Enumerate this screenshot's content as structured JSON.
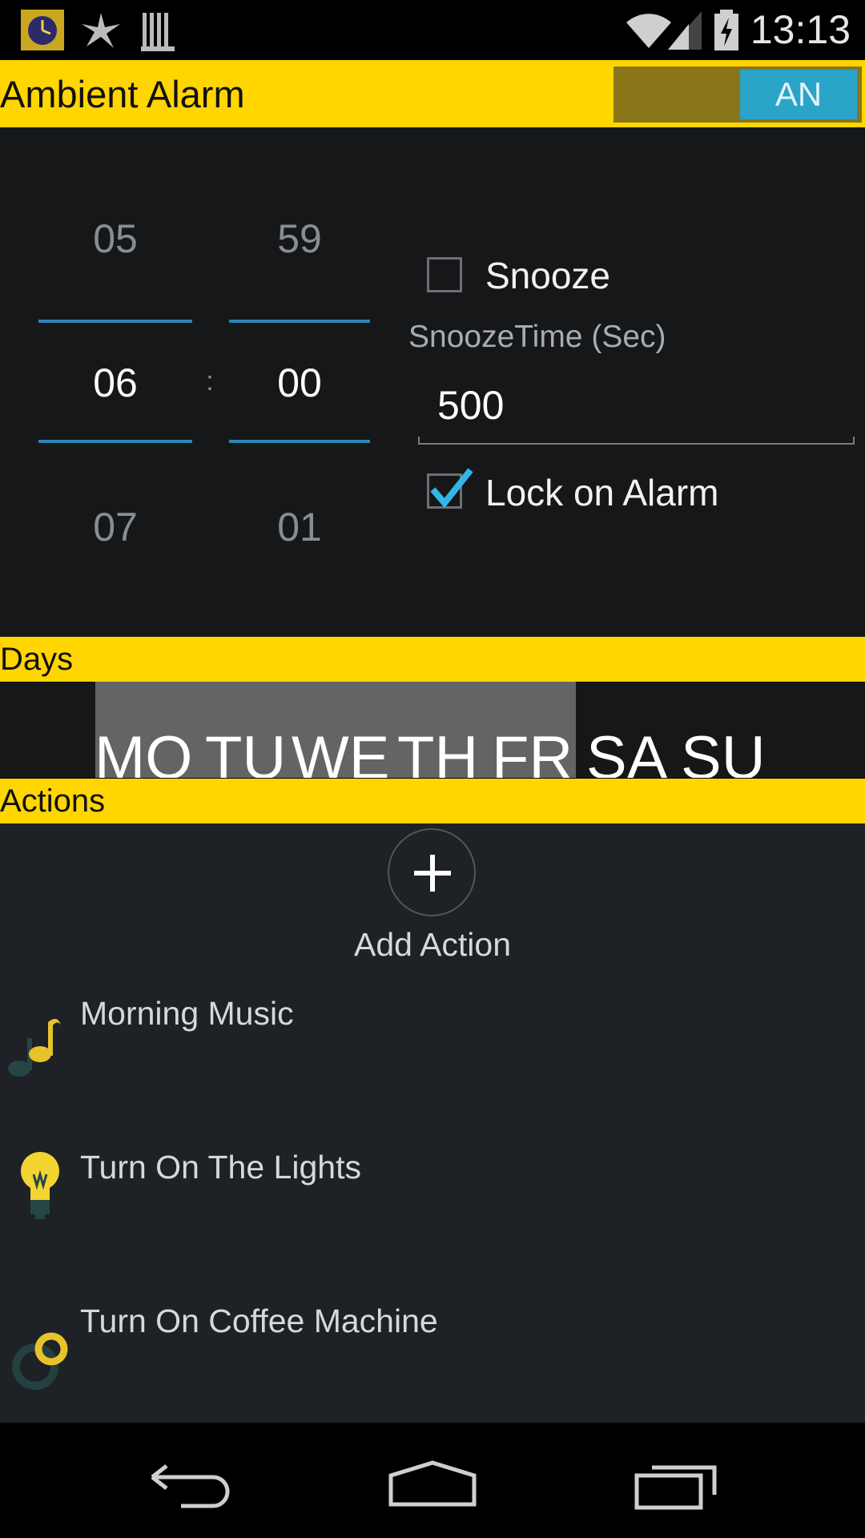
{
  "status_bar": {
    "time": "13:13",
    "icons": [
      "clock-app-icon",
      "pinwheel-icon",
      "barcode-icon",
      "wifi-icon",
      "signal-icon",
      "battery-charging-icon"
    ]
  },
  "header": {
    "title": "Ambient Alarm",
    "toggle_label": "AN",
    "toggle_on": true
  },
  "time_picker": {
    "hour_prev": "05",
    "hour": "06",
    "hour_next": "07",
    "separator": ":",
    "minute_prev": "59",
    "minute": "00",
    "minute_next": "01"
  },
  "settings": {
    "snooze_label": "Snooze",
    "snooze_checked": false,
    "snooze_time_label": "SnoozeTime (Sec)",
    "snooze_time_value": "500",
    "lock_label": "Lock on Alarm",
    "lock_checked": true
  },
  "days": {
    "header": "Days",
    "items": [
      "MO",
      "TU",
      "WE",
      "TH",
      "FR",
      "SA",
      "SU"
    ],
    "selected": [
      "MO",
      "TU",
      "WE",
      "TH",
      "FR"
    ]
  },
  "actions": {
    "header": "Actions",
    "add_label": "Add Action",
    "items": [
      {
        "label": "Morning Music",
        "icon": "music-note-icon"
      },
      {
        "label": "Turn On The Lights",
        "icon": "lightbulb-icon"
      },
      {
        "label": "Turn On Coffee Machine",
        "icon": "coffee-machine-icon"
      }
    ]
  },
  "nav": [
    "back-icon",
    "home-icon",
    "recents-icon"
  ],
  "colors": {
    "accent_yellow": "#ffd600",
    "toggle_blue": "#2aa4c8",
    "picker_line": "#2e86b4",
    "background": "#151719"
  }
}
